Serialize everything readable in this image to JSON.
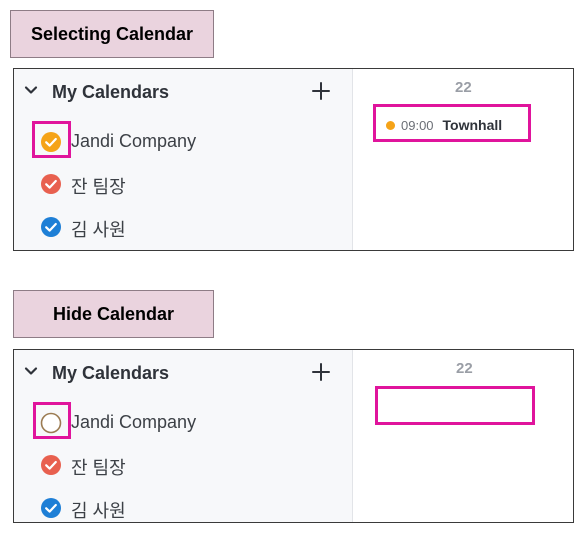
{
  "sections": [
    {
      "label": "Selecting Calendar",
      "header": "My Calendars",
      "day": "22",
      "calendars": [
        {
          "name": "Jandi Company",
          "checked": true,
          "color": "#f5a318"
        },
        {
          "name": "잔 팀장",
          "checked": true,
          "color": "#e8604f"
        },
        {
          "name": "김 사원",
          "checked": true,
          "color": "#1e7fd6"
        }
      ],
      "event": {
        "time": "09:00",
        "title": "Townhall",
        "dot_color": "#f5a318"
      }
    },
    {
      "label": "Hide Calendar",
      "header": "My Calendars",
      "day": "22",
      "calendars": [
        {
          "name": "Jandi Company",
          "checked": false,
          "color": "#9b7b52"
        },
        {
          "name": "잔 팀장",
          "checked": true,
          "color": "#e8604f"
        },
        {
          "name": "김 사원",
          "checked": true,
          "color": "#1e7fd6"
        }
      ]
    }
  ],
  "colors": {
    "highlight": "#e0149c",
    "label_bg": "#ead3de"
  }
}
